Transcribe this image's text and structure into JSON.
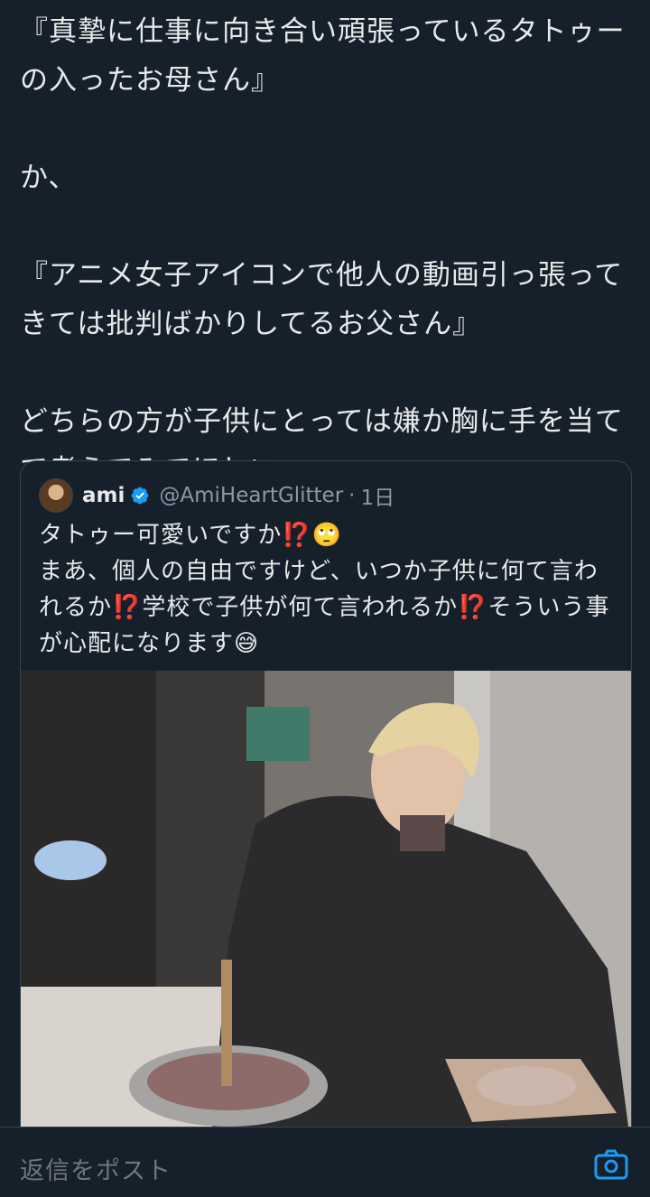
{
  "tweet": {
    "lines": [
      "『真摯に仕事に向き合い頑張っているタトゥーの入ったお母さん』",
      "",
      "か、",
      "",
      "『アニメ女子アイコンで他人の動画引っ張ってきては批判ばかりしてるお父さん』",
      "",
      "どちらの方が子供にとっては嫌か胸に手を当てて考えてみてほしい。"
    ]
  },
  "quote": {
    "name": "ami",
    "handle": "@AmiHeartGlitter",
    "separator": "·",
    "time": "1日",
    "text_lines": [
      "タトゥー可愛いですか⁉️🙄",
      "まあ、個人の自由ですけど、いつか子供に何て言われるか⁉️学校で子供が何て言われるか⁉️そういう事が心配になります😅"
    ]
  },
  "reply": {
    "placeholder": "返信をポスト"
  },
  "icons": {
    "verified": "verified-badge-icon",
    "camera": "camera-icon"
  },
  "colors": {
    "background": "#15202b",
    "text": "#e7e9ea",
    "muted": "#8b98a5",
    "accent": "#1d9bf0",
    "border": "#38444d"
  }
}
